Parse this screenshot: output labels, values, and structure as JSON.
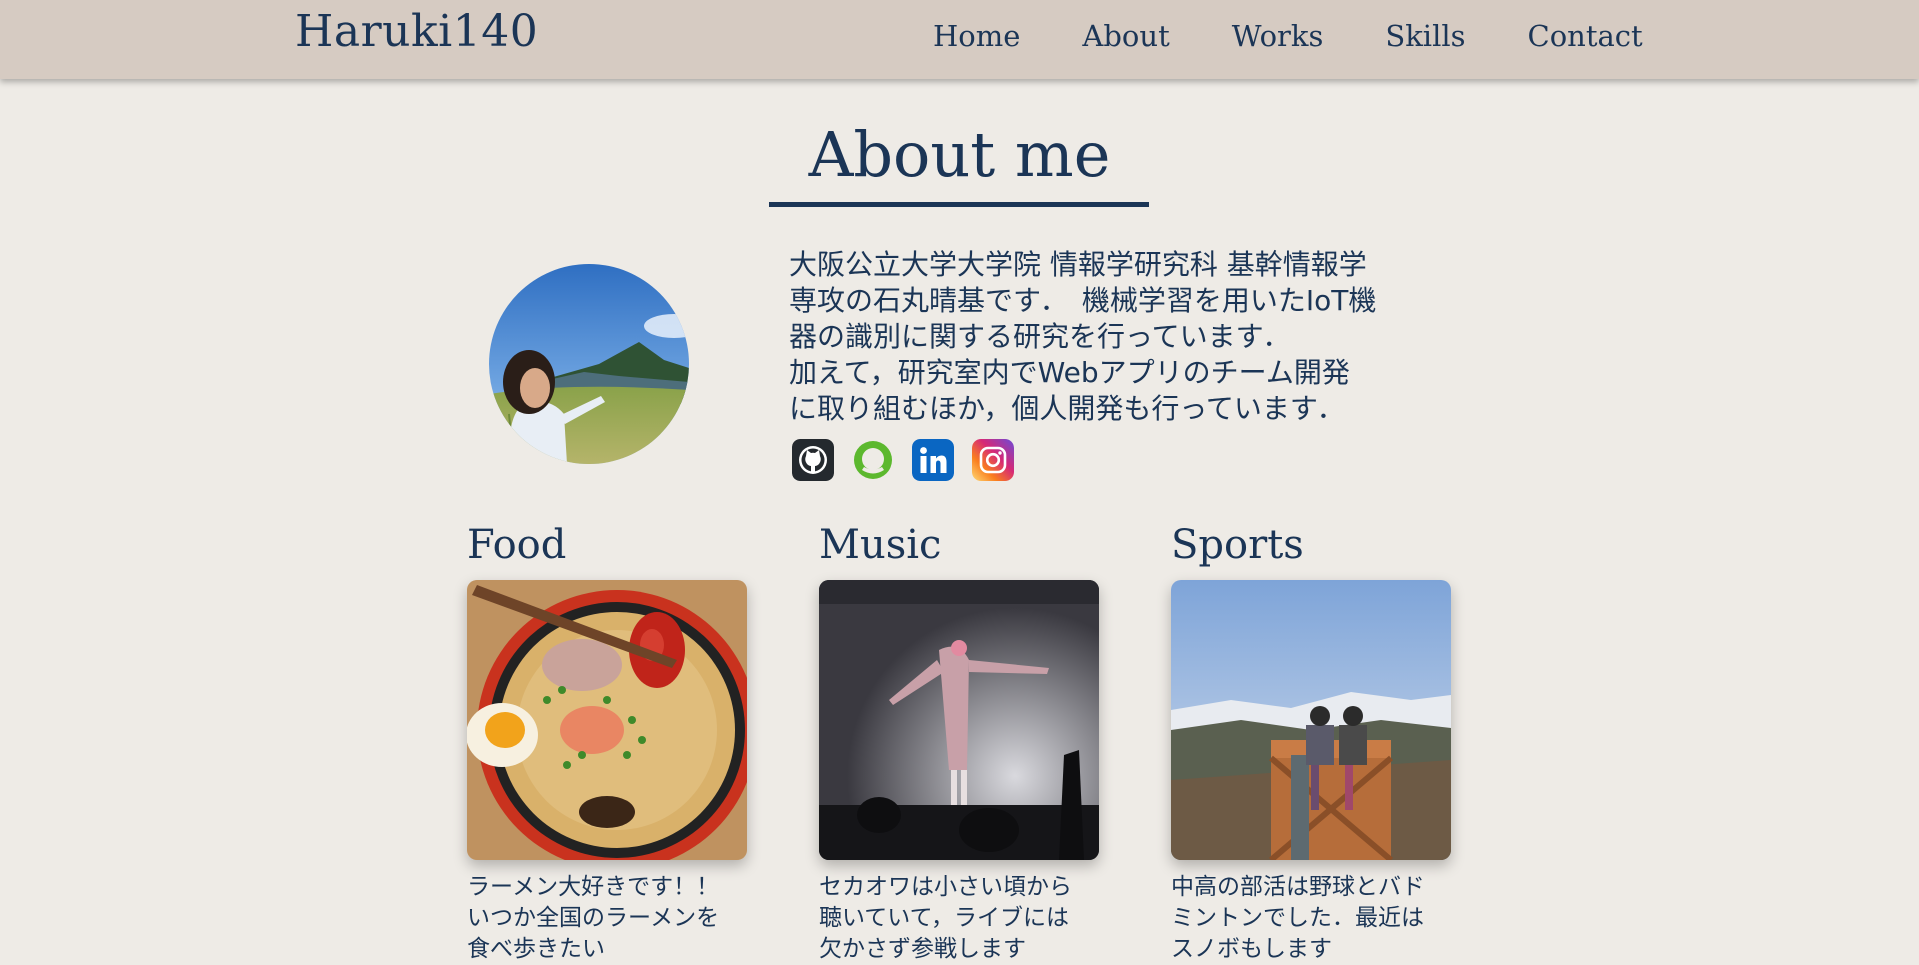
{
  "nav": {
    "brand": "Haruki140",
    "links": [
      "Home",
      "About",
      "Works",
      "Skills",
      "Contact"
    ]
  },
  "about": {
    "title": "About me",
    "bio_lines": [
      "大阪公立大学大学院 情報学研究科 基幹情報学",
      "専攻の石丸晴基です．　機械学習を用いたIoT機",
      "器の識別に関する研究を行っています．",
      "加えて，研究室内でWebアプリのチーム開発",
      "に取り組むほか，個人開発も行っています．"
    ],
    "social_icons": [
      "github-icon",
      "atcoder-icon",
      "linkedin-icon",
      "instagram-icon"
    ]
  },
  "hobbies": [
    {
      "title": "Food",
      "desc_lines": [
        "ラーメン大好きです！！",
        "いつか全国のラーメンを",
        "食べ歩きたい"
      ]
    },
    {
      "title": "Music",
      "desc_lines": [
        "セカオワは小さい頃から",
        "聴いていて，ライブには",
        "欠かさず参戦します"
      ]
    },
    {
      "title": "Sports",
      "desc_lines": [
        "中高の部活は野球とバド",
        "ミントンでした．最近は",
        "スノボもします"
      ]
    }
  ],
  "colors": {
    "navbar_bg": "#d6cbc2",
    "page_bg": "#eeebe6",
    "text": "#1b3556"
  }
}
